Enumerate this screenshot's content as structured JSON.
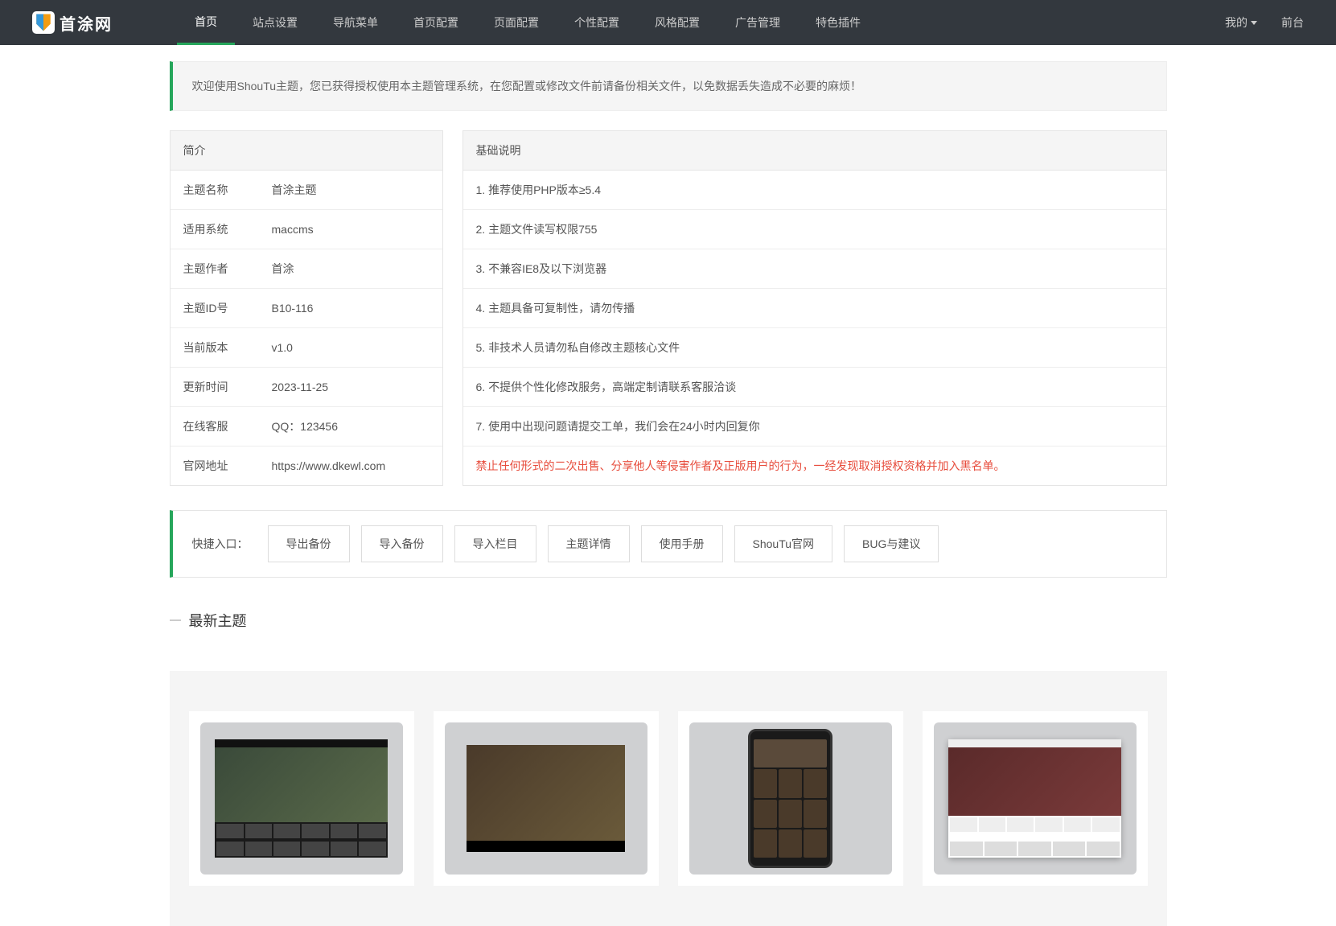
{
  "brand": {
    "name": "首涂网"
  },
  "nav": {
    "items": [
      {
        "label": "首页",
        "active": true
      },
      {
        "label": "站点设置"
      },
      {
        "label": "导航菜单"
      },
      {
        "label": "首页配置"
      },
      {
        "label": "页面配置"
      },
      {
        "label": "个性配置"
      },
      {
        "label": "风格配置"
      },
      {
        "label": "广告管理"
      },
      {
        "label": "特色插件"
      }
    ],
    "right": {
      "mine": "我的",
      "front": "前台"
    }
  },
  "welcome": "欢迎使用ShouTu主题，您已获得授权使用本主题管理系统，在您配置或修改文件前请备份相关文件，以免数据丢失造成不必要的麻烦！",
  "intro": {
    "title": "简介",
    "rows": [
      {
        "k": "主题名称",
        "v": "首涂主题"
      },
      {
        "k": "适用系统",
        "v": "maccms"
      },
      {
        "k": "主题作者",
        "v": "首涂"
      },
      {
        "k": "主题ID号",
        "v": "B10-116"
      },
      {
        "k": "当前版本",
        "v": "v1.0"
      },
      {
        "k": "更新时间",
        "v": "2023-11-25"
      },
      {
        "k": "在线客服",
        "v": "QQ：123456"
      },
      {
        "k": "官网地址",
        "v": "https://www.dkewl.com"
      }
    ]
  },
  "rules": {
    "title": "基础说明",
    "items": [
      "1. 推荐使用PHP版本≥5.4",
      "2. 主题文件读写权限755",
      "3. 不兼容IE8及以下浏览器",
      "4. 主题具备可复制性，请勿传播",
      "5. 非技术人员请勿私自修改主题核心文件",
      "6. 不提供个性化修改服务，高端定制请联系客服洽谈",
      "7. 使用中出现问题请提交工单，我们会在24小时内回复你"
    ],
    "warning": "禁止任何形式的二次出售、分享他人等侵害作者及正版用户的行为，一经发现取消授权资格并加入黑名单。"
  },
  "quick": {
    "label": "快捷入口：",
    "buttons": [
      "导出备份",
      "导入备份",
      "导入栏目",
      "主题详情",
      "使用手册",
      "ShouTu官网",
      "BUG与建议"
    ]
  },
  "section": {
    "latest": "最新主题"
  }
}
